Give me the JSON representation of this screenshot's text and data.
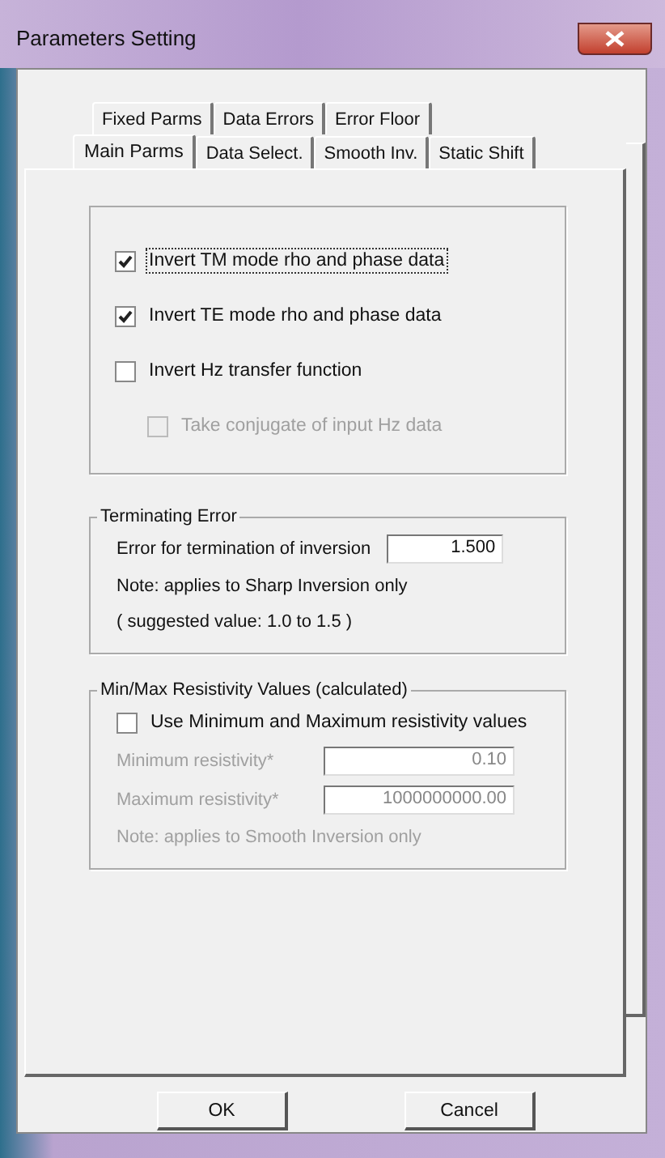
{
  "window": {
    "title": "Parameters Setting"
  },
  "tab_rows": [
    [
      {
        "label": "Fixed Parms",
        "selected": false
      },
      {
        "label": "Data Errors",
        "selected": false
      },
      {
        "label": "Error Floor",
        "selected": false
      }
    ],
    [
      {
        "label": "Main Parms",
        "selected": true
      },
      {
        "label": "Data Select.",
        "selected": false
      },
      {
        "label": "Smooth Inv.",
        "selected": false
      },
      {
        "label": "Static Shift",
        "selected": false
      }
    ]
  ],
  "invert_options": [
    {
      "label": "Invert TM mode rho and phase data",
      "checked": true,
      "disabled": false,
      "focused": true,
      "indented": false
    },
    {
      "label": "Invert TE mode rho and phase data",
      "checked": true,
      "disabled": false,
      "focused": false,
      "indented": false
    },
    {
      "label": "Invert Hz transfer function",
      "checked": false,
      "disabled": false,
      "focused": false,
      "indented": false
    },
    {
      "label": "Take conjugate of input Hz data",
      "checked": false,
      "disabled": true,
      "focused": false,
      "indented": true
    }
  ],
  "terminating_error": {
    "title": "Terminating Error",
    "field_label": "Error for termination of inversion",
    "value": "1.500",
    "notes": [
      "Note: applies to Sharp Inversion only",
      "( suggested value: 1.0 to 1.5 )"
    ]
  },
  "resistivity": {
    "title": "Min/Max Resistivity Values (calculated)",
    "checkbox": {
      "label": "Use Minimum and Maximum resistivity values",
      "checked": false
    },
    "fields": [
      {
        "label": "Minimum resistivity*",
        "value": "0.10",
        "disabled": true
      },
      {
        "label": "Maximum resistivity*",
        "value": "1000000000.00",
        "disabled": true
      }
    ],
    "note": "Note: applies to Smooth Inversion only",
    "note_disabled": true
  },
  "buttons": [
    "OK",
    "Cancel"
  ]
}
